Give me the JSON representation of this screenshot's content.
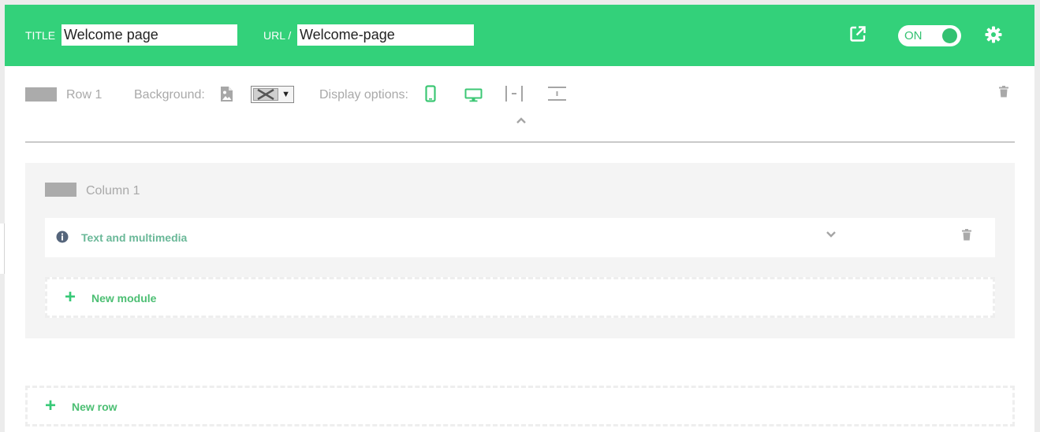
{
  "header": {
    "title_label": "TITLE",
    "title_value": "Welcome page",
    "url_label": "URL /",
    "url_value": "Welcome-page",
    "toggle_label": "ON",
    "icons": {
      "open_external": "external-link-icon",
      "settings": "gear-icon"
    }
  },
  "row": {
    "label": "Row 1",
    "background_label": "Background:",
    "display_options_label": "Display options:",
    "icons": [
      "image-icon",
      "mobile-icon",
      "desktop-icon",
      "full-width-icon",
      "vertical-spacing-icon",
      "collapse-chevron-up-icon",
      "trash-icon"
    ]
  },
  "column": {
    "label": "Column 1"
  },
  "module": {
    "title": "Text and multimedia",
    "icons": [
      "info-icon",
      "chevron-down-icon",
      "trash-icon"
    ]
  },
  "actions": {
    "new_module": "New module",
    "new_row": "New row"
  },
  "colors": {
    "brand_green": "#33d17a",
    "accent_green": "#37c977",
    "muted_text": "#a9a9a9"
  }
}
